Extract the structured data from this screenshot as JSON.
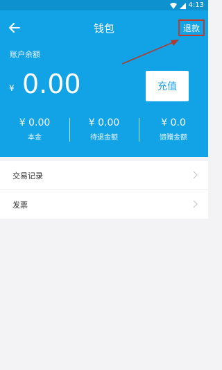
{
  "status": {
    "time": "4:13"
  },
  "nav": {
    "title": "钱包",
    "refund_label": "退款"
  },
  "balance": {
    "label": "账户余额",
    "currency": "¥",
    "amount": "0.00"
  },
  "recharge_label": "充值",
  "stats": [
    {
      "value": "¥ 0.00",
      "label": "本金"
    },
    {
      "value": "¥ 0.00",
      "label": "待退金额"
    },
    {
      "value": "¥ 0.0",
      "label": "馈赠金额"
    }
  ],
  "menu": [
    {
      "label": "交易记录"
    },
    {
      "label": "发票"
    }
  ],
  "colors": {
    "primary": "#12a2e6",
    "highlight": "#c0392b"
  }
}
